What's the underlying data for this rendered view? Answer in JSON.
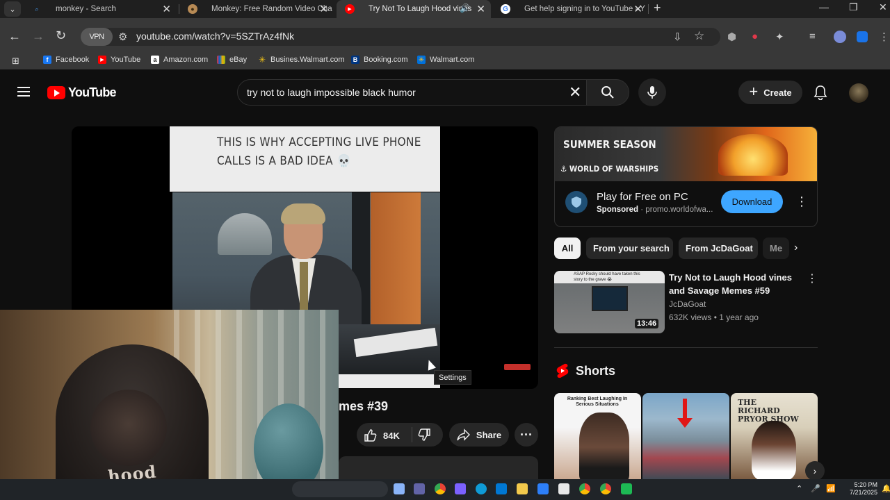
{
  "browser": {
    "tabs": [
      {
        "title": "monkey - Search",
        "active": false
      },
      {
        "title": "Monkey: Free Random Video Cha",
        "active": false
      },
      {
        "title": "Try Not To Laugh Hood vines",
        "active": true
      },
      {
        "title": "Get help signing in to YouTube - Y",
        "active": false
      }
    ],
    "url": "youtube.com/watch?v=5SZTrAz4fNk",
    "vpn_label": "VPN",
    "bookmarks": [
      "Facebook",
      "YouTube",
      "Amazon.com",
      "eBay",
      "Busines.Walmart.com",
      "Booking.com",
      "Walmart.com"
    ]
  },
  "youtube": {
    "logo_text": "YouTube",
    "search_query": "try not to laugh impossible black humor",
    "create_label": "Create"
  },
  "player": {
    "caption": "THIS IS WHY ACCEPTING LIVE PHONE CALLS IS A BAD IDEA 💀",
    "tooltip": "Settings"
  },
  "webcam": {
    "shirt_print": "hood"
  },
  "video": {
    "title_fragment": "mes #39",
    "like_count": "84K",
    "share_label": "Share"
  },
  "ad": {
    "headline": "SUMMER SEASON",
    "brand": "WORLD OF WARSHIPS",
    "title": "Play for Free on PC",
    "sponsored": "Sponsored",
    "domain": "promo.worldofwa...",
    "cta": "Download"
  },
  "chips": [
    "All",
    "From your search",
    "From JcDaGoat",
    "Me"
  ],
  "recommendation": {
    "title": "Try Not to Laugh Hood vines and Savage Memes #59",
    "channel": "JcDaGoat",
    "stats": "632K views • 1 year ago",
    "duration": "13:46",
    "thumb_caption": "ASAP Rocky should have taken this story to the grave 😭"
  },
  "shorts": {
    "label": "Shorts",
    "items": [
      {
        "overlay": "Ranking Best Laughing In Serious Situations"
      },
      {
        "overlay": ""
      },
      {
        "overlay": "THE RICHARD PRYOR SHOW"
      }
    ]
  },
  "taskbar": {
    "time": "5:20 PM",
    "date": "7/21/2025"
  },
  "colors": {
    "brand_red": "#ff0000",
    "accent_blue": "#3ea6ff",
    "background": "#0f0f0f"
  }
}
